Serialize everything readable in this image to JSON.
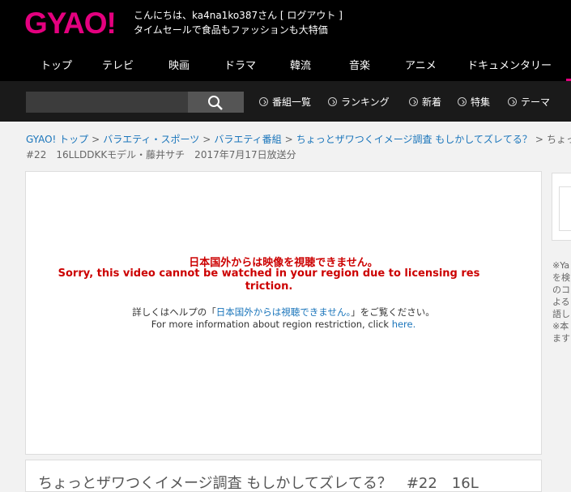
{
  "brand": {
    "logo": "GYAO!"
  },
  "header": {
    "greeting": "こんにちは、ka4na1ko387さん [ ログアウト ]",
    "promo": "タイムセールで食品もファッションも大特価"
  },
  "nav": {
    "items": [
      "トップ",
      "テレビ",
      "映画",
      "ドラマ",
      "韓流",
      "音楽",
      "アニメ",
      "ドキュメンタリー"
    ]
  },
  "search": {
    "value": ""
  },
  "subnav": {
    "items": [
      "番組一覧",
      "ランキング",
      "新着",
      "特集",
      "テーマ"
    ]
  },
  "breadcrumb": {
    "items": [
      "GYAO! トップ",
      "バラエティ・スポーツ",
      "バラエティ番組",
      "ちょっとザワつくイメージ調査 もしかしてズレてる？",
      "ちょっ"
    ],
    "separator": ">"
  },
  "episode": {
    "line": "#22　16LLDDKKモデル・藤井サチ　2017年7月17日放送分"
  },
  "player": {
    "error_ja": "日本国外からは映像を視聴できません。",
    "error_en": "Sorry, this video cannot be watched in your region due to licensing res triction.",
    "info_ja_prefix": "詳しくはヘルプの「",
    "info_ja_link": "日本国外からは視聴できません。",
    "info_ja_suffix": "」をご覧ください。",
    "info_en_prefix": "For more information about region restriction, click ",
    "info_en_link": "here."
  },
  "sidebar": {
    "notes": [
      "※Ya",
      "を検",
      "のコ",
      "よる",
      "語し",
      "※本",
      "ます"
    ]
  },
  "program": {
    "title": "ちょっとザワつくイメージ調査 もしかしてズレてる？　#22　16L"
  },
  "colors": {
    "brand": "#e4007f",
    "link": "#1a75bb",
    "error": "#cc0000",
    "header_bg": "#000000",
    "subbar_bg": "#1a1a1a"
  }
}
